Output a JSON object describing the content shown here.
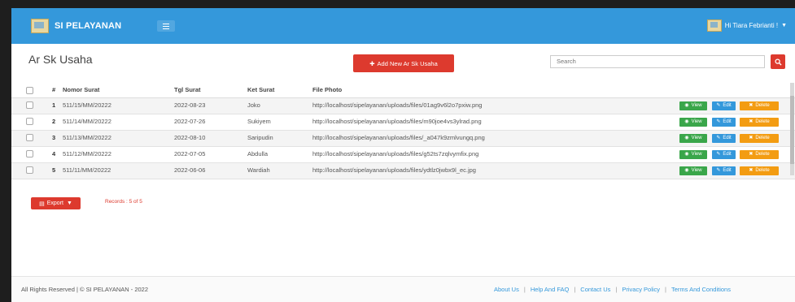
{
  "navbar": {
    "brand": "SI PELAYANAN",
    "user_greeting": "Hi Tiara Febrianti !"
  },
  "page": {
    "title": "Ar Sk Usaha",
    "add_button": "Add New Ar Sk Usaha",
    "search_placeholder": "Search"
  },
  "table": {
    "headers": {
      "num": "#",
      "nomor": "Nomor Surat",
      "tgl": "Tgl Surat",
      "ket": "Ket Surat",
      "file": "File Photo"
    },
    "rows": [
      {
        "num": "1",
        "nomor": "511/15/MM/20222",
        "tgl": "2022-08-23",
        "ket": "Joko",
        "file": "http://localhost/sipelayanan/uploads/files/01ag9v6l2o7pxiw.png"
      },
      {
        "num": "2",
        "nomor": "511/14/MM/20222",
        "tgl": "2022-07-26",
        "ket": "Sukiyem",
        "file": "http://localhost/sipelayanan/uploads/files/m90joe4vs3ylrad.png"
      },
      {
        "num": "3",
        "nomor": "511/13/MM/20222",
        "tgl": "2022-08-10",
        "ket": "Saripudin",
        "file": "http://localhost/sipelayanan/uploads/files/_a047k9zmlvungq.png"
      },
      {
        "num": "4",
        "nomor": "511/12/MM/20222",
        "tgl": "2022-07-05",
        "ket": "Abdulla",
        "file": "http://localhost/sipelayanan/uploads/files/g52ts7zqlvymfix.png"
      },
      {
        "num": "5",
        "nomor": "511/11/MM/20222",
        "tgl": "2022-06-06",
        "ket": "Wardiah",
        "file": "http://localhost/sipelayanan/uploads/files/ydtlz0jwbx9l_ec.jpg"
      }
    ],
    "actions": {
      "view": "View",
      "edit": "Edit",
      "delete": "Delete"
    }
  },
  "export": {
    "label": "Export",
    "records": "Records : 5 of 5"
  },
  "footer": {
    "copyright": "All Rights Reserved | © SI PELAYANAN - 2022",
    "links": [
      "About Us",
      "Help And FAQ",
      "Contact Us",
      "Privacy Policy",
      "Terms And Conditions"
    ]
  },
  "colors": {
    "navbar": "#3498db",
    "danger": "#dd3a2e",
    "success": "#3aa64a",
    "info": "#3498db",
    "warning": "#f39c12"
  }
}
